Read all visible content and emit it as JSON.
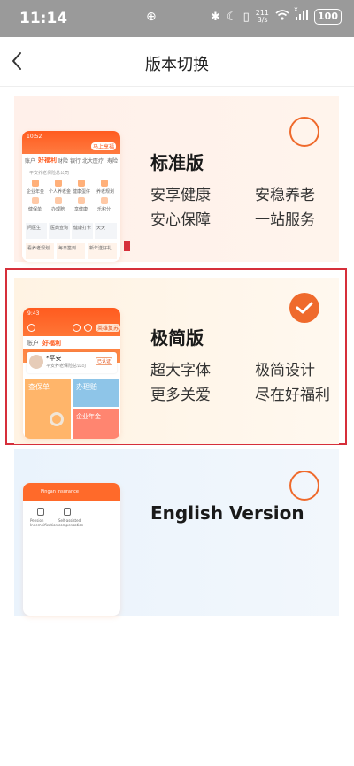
{
  "status_bar": {
    "time": "11:14",
    "net_speed_top": "211",
    "net_speed_bottom": "B/s",
    "battery": "100",
    "signal_x": "x"
  },
  "nav": {
    "title": "版本切换"
  },
  "cards": [
    {
      "title": "标准版",
      "features": [
        "安享健康",
        "安稳养老",
        "安心保障",
        "一站服务"
      ],
      "selected": false,
      "mock": {
        "time": "10:52",
        "tabs": [
          "账户",
          "好福利",
          "财险",
          "银行",
          "北大医疗",
          "寿险"
        ],
        "badge": "马上享福",
        "company": "平安养老保险总公司",
        "icons": [
          "企业年金",
          "个人养老金",
          "健康蛋仔",
          "养老规划",
          "健保单",
          "办理赔",
          "享健康",
          "乐积分"
        ],
        "cards": [
          "问医生",
          "医典查询",
          "健康打卡",
          "天天"
        ],
        "bottom": [
          "看养老规划",
          "每日签到",
          "新年送好礼"
        ]
      }
    },
    {
      "title": "极简版",
      "features": [
        "超大字体",
        "极简设计",
        "更多关爱",
        "尽在好福利"
      ],
      "selected": true,
      "mock": {
        "time": "9:43",
        "tabs": [
          "账户",
          "好福利"
        ],
        "badge": "英雄复苏",
        "user": "*平安",
        "company": "平安养老保险总公司",
        "tag": "已认证",
        "tiles": [
          "查保单",
          "办理赔",
          "企业年金"
        ]
      }
    },
    {
      "title": "English Version",
      "features": [],
      "selected": false,
      "mock": {
        "header": "Pingan Insurance",
        "items": [
          "Pension Indemnification",
          "Self-assisted compensation"
        ]
      }
    }
  ],
  "colors": {
    "accent": "#ef6a2c",
    "selected_outline": "#d62f3a",
    "status_bar": "#9a9a9a"
  }
}
